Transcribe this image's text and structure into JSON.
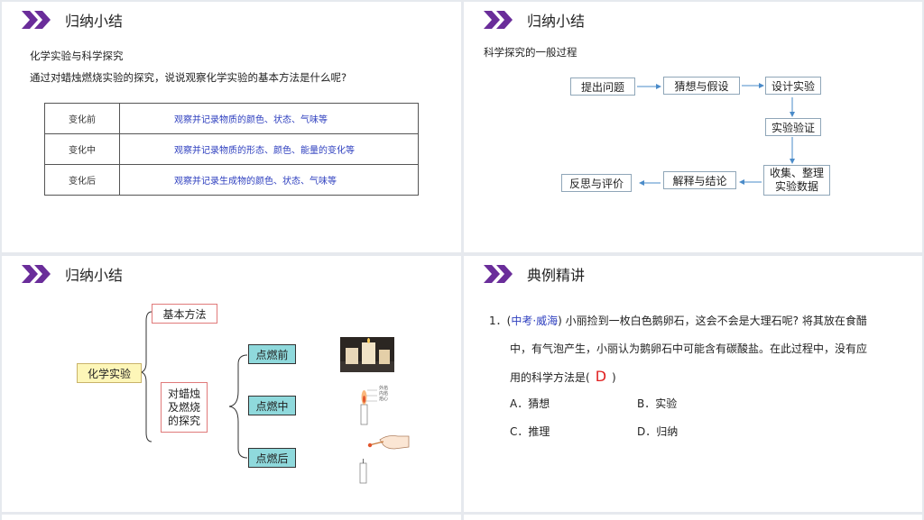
{
  "slide1": {
    "title": "归纳小结",
    "subtitle": "化学实验与科学探究",
    "question": "通过对蜡烛燃烧实验的探究，说说观察化学实验的基本方法是什么呢?",
    "table": [
      {
        "stage": "变化前",
        "desc": "观察并记录物质的颜色、状态、气味等"
      },
      {
        "stage": "变化中",
        "desc": "观察并记录物质的形态、颜色、能量的变化等"
      },
      {
        "stage": "变化后",
        "desc": "观察并记录生成物的颜色、状态、气味等"
      }
    ]
  },
  "slide2": {
    "title": "归纳小结",
    "subtitle": "科学探究的一般过程",
    "steps": {
      "s1": "提出问题",
      "s2": "猜想与假设",
      "s3": "设计实验",
      "s4": "实验验证",
      "s5a": "收集、整理",
      "s5b": "实验数据",
      "s6": "解释与结论",
      "s7": "反思与评价"
    }
  },
  "slide3": {
    "title": "归纳小结",
    "root": "化学实验",
    "branch1": "基本方法",
    "branch2_l1": "对蜡烛",
    "branch2_l2": "及燃烧",
    "branch2_l3": "的探究",
    "leaf1": "点燃前",
    "leaf2": "点燃中",
    "leaf3": "点燃后",
    "flame_labels": [
      "外焰",
      "内焰",
      "焰心"
    ]
  },
  "slide4": {
    "title": "典例精讲",
    "number": "1．(",
    "source": "中考·威海",
    "line1_rest": ") 小丽捡到一枚白色鹅卵石，这会不会是大理石呢? 将其放在食醋",
    "line2": "中，有气泡产生，小丽认为鹅卵石中可能含有碳酸盐。在此过程中，没有应",
    "line3_pre": "用的科学方法是(",
    "answer": "D",
    "line3_post": ")",
    "options": {
      "a": "A．猜想",
      "b": "B．实验",
      "c": "C．推理",
      "d": "D．归纳"
    }
  },
  "colors": {
    "accent": "#6a2d9a",
    "link": "#2e3fbf",
    "answer": "#e02020",
    "teal": "#8fd9dc",
    "yellow": "#fdf6b8"
  }
}
